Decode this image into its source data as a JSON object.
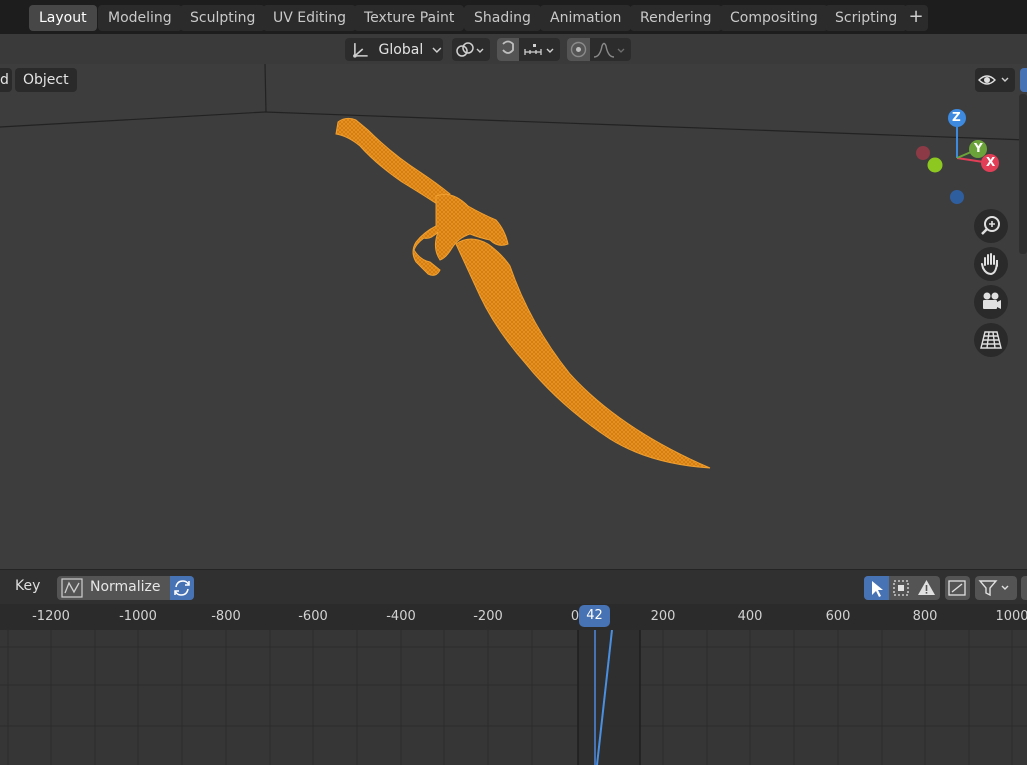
{
  "workspace_tabs": [
    "Layout",
    "Modeling",
    "Sculpting",
    "UV Editing",
    "Texture Paint",
    "Shading",
    "Animation",
    "Rendering",
    "Compositing",
    "Scripting"
  ],
  "active_tab": "Layout",
  "add_tab_label": "+",
  "viewport_header": {
    "transform_orientation": "Global",
    "left_cut_label": "d",
    "mode_label": "Object"
  },
  "gizmo": {
    "z_label": "Z",
    "y_label": "Y",
    "x_label": "X"
  },
  "timeline": {
    "key_label": "Key",
    "normalize_label": "Normalize",
    "current_frame": "42",
    "ruler_ticks": [
      "-1200",
      "-1000",
      "-800",
      "-600",
      "-400",
      "-200",
      "0",
      "200",
      "400",
      "600",
      "800",
      "1000"
    ]
  },
  "colors": {
    "accent": "#4772b3",
    "object_selected": "#e8901c",
    "axis_x": "#e23e57",
    "axis_y": "#6ba33a",
    "axis_z": "#3d8ae0"
  }
}
